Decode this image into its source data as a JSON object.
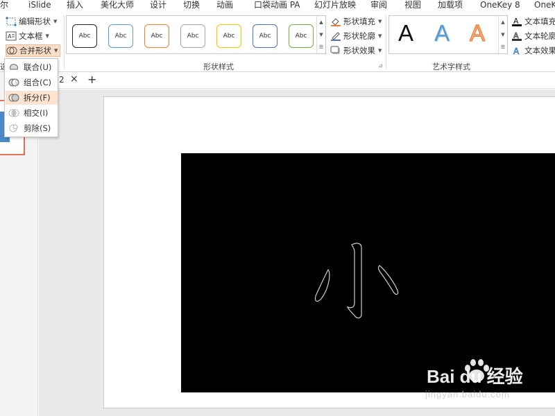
{
  "tabs": [
    {
      "label": "尔"
    },
    {
      "label": "iSlide"
    },
    {
      "label": "插入"
    },
    {
      "label": "美化大师"
    },
    {
      "label": "设计"
    },
    {
      "label": "切换"
    },
    {
      "label": "动画"
    },
    {
      "label": "口袋动画 PA"
    },
    {
      "label": "幻灯片放映"
    },
    {
      "label": "审阅"
    },
    {
      "label": "视图"
    },
    {
      "label": "加载项"
    },
    {
      "label": "OneKey 8"
    },
    {
      "label": "OneK"
    }
  ],
  "ribbon": {
    "edit_shape": "编辑形状",
    "text_box": "文本框",
    "merge_shapes": "合并形状",
    "shape_fill": "形状填充",
    "shape_outline": "形状轮廓",
    "shape_effects": "形状效果",
    "text_fill": "文本填充",
    "text_outline": "文本轮廓",
    "text_effects": "文本效果",
    "shape_styles_label": "形状样式",
    "wordart_label": "艺术字样式",
    "thumb_text": "Abc",
    "wordart_letter": "A",
    "thumb_colors": [
      "#222222",
      "#5b9bd5",
      "#ed7d31",
      "#a5a5a5",
      "#ffc000",
      "#4472c4",
      "#70ad47"
    ],
    "left_cut_label": "选"
  },
  "menu": {
    "items": [
      {
        "label": "联合(U)"
      },
      {
        "label": "组合(C)"
      },
      {
        "label": "拆分(F)"
      },
      {
        "label": "相交(I)"
      },
      {
        "label": "剪除(S)"
      }
    ],
    "active_index": 2
  },
  "doc_tab": {
    "label": "2",
    "close": "×",
    "add": "+"
  },
  "slide": {
    "glyph": "小"
  },
  "watermark": {
    "brand": "Bai du 经验",
    "url": "jingyan.baidu.com"
  }
}
